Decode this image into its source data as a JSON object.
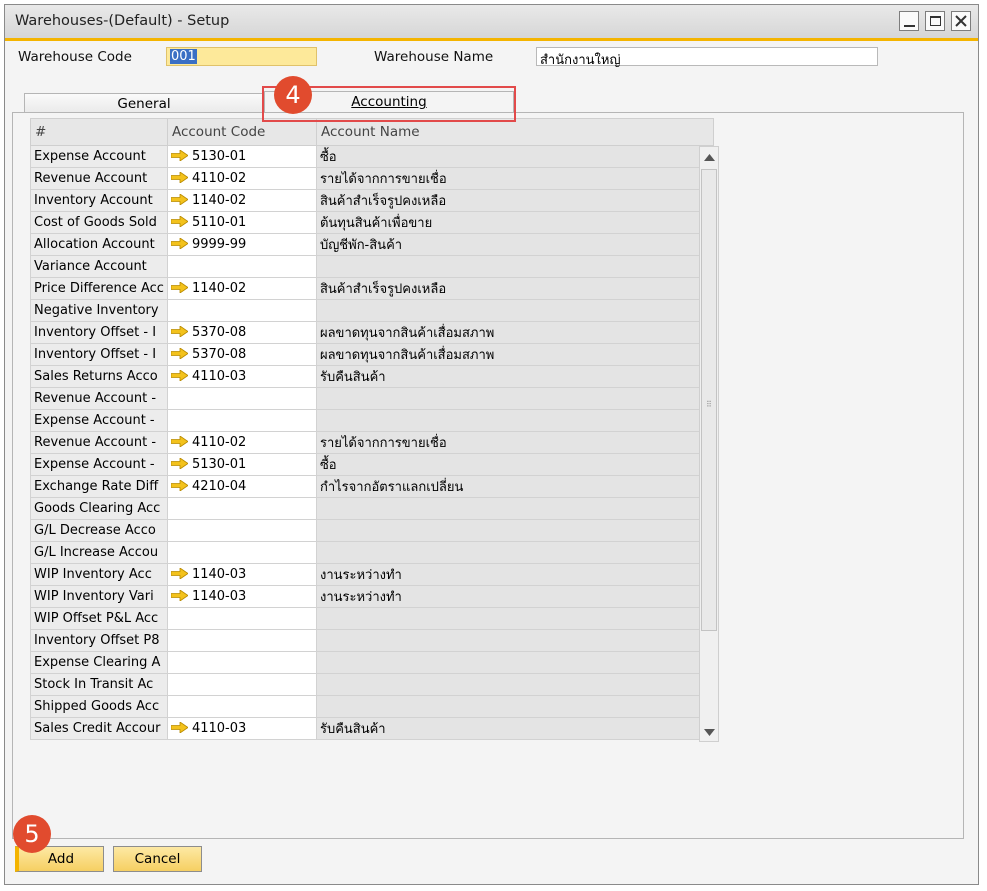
{
  "window": {
    "title": "Warehouses-(Default) - Setup"
  },
  "header": {
    "warehouse_code_label": "Warehouse Code",
    "warehouse_code_value": "001",
    "warehouse_name_label": "Warehouse Name",
    "warehouse_name_value": "สำนักงานใหญ่"
  },
  "tabs": {
    "general": "General",
    "accounting": "Accounting"
  },
  "grid": {
    "columns": [
      "#",
      "Account Code",
      "Account Name"
    ],
    "rows": [
      {
        "label": "Expense Account",
        "code": "5130-01",
        "name": "ซื้อ"
      },
      {
        "label": "Revenue Account",
        "code": "4110-02",
        "name": "รายได้จากการขายเชื่อ"
      },
      {
        "label": "Inventory Account",
        "code": "1140-02",
        "name": "สินค้าสำเร็จรูปคงเหลือ"
      },
      {
        "label": "Cost of Goods Sold",
        "code": "5110-01",
        "name": "ต้นทุนสินค้าเพื่อขาย"
      },
      {
        "label": "Allocation Account",
        "code": "9999-99",
        "name": "บัญชีพัก-สินค้า"
      },
      {
        "label": "Variance Account",
        "code": "",
        "name": ""
      },
      {
        "label": "Price Difference Acc",
        "code": "1140-02",
        "name": "สินค้าสำเร็จรูปคงเหลือ"
      },
      {
        "label": "Negative Inventory",
        "code": "",
        "name": ""
      },
      {
        "label": "Inventory Offset - I",
        "code": "5370-08",
        "name": "ผลขาดทุนจากสินค้าเสื่อมสภาพ"
      },
      {
        "label": "Inventory Offset - I",
        "code": "5370-08",
        "name": "ผลขาดทุนจากสินค้าเสื่อมสภาพ"
      },
      {
        "label": "Sales Returns Acco",
        "code": "4110-03",
        "name": "รับคืนสินค้า"
      },
      {
        "label": "Revenue Account -",
        "code": "",
        "name": ""
      },
      {
        "label": "Expense Account -",
        "code": "",
        "name": ""
      },
      {
        "label": "Revenue Account -",
        "code": "4110-02",
        "name": "รายได้จากการขายเชื่อ"
      },
      {
        "label": "Expense Account -",
        "code": "5130-01",
        "name": "ซื้อ"
      },
      {
        "label": "Exchange Rate Diff",
        "code": "4210-04",
        "name": "กำไรจากอัตราแลกเปลี่ยน"
      },
      {
        "label": "Goods Clearing Acc",
        "code": "",
        "name": ""
      },
      {
        "label": "G/L Decrease Acco",
        "code": "",
        "name": ""
      },
      {
        "label": "G/L Increase Accou",
        "code": "",
        "name": ""
      },
      {
        "label": "WIP Inventory Acc",
        "code": "1140-03",
        "name": "งานระหว่างทำ"
      },
      {
        "label": "WIP Inventory Vari",
        "code": "1140-03",
        "name": "งานระหว่างทำ"
      },
      {
        "label": "WIP Offset P&L Acc",
        "code": "",
        "name": ""
      },
      {
        "label": "Inventory Offset P8",
        "code": "",
        "name": ""
      },
      {
        "label": "Expense Clearing A",
        "code": "",
        "name": ""
      },
      {
        "label": "Stock In Transit Ac",
        "code": "",
        "name": ""
      },
      {
        "label": "Shipped Goods Acc",
        "code": "",
        "name": ""
      },
      {
        "label": "Sales Credit Accour",
        "code": "4110-03",
        "name": "รับคืนสินค้า"
      }
    ]
  },
  "buttons": {
    "add": "Add",
    "cancel": "Cancel"
  },
  "callouts": {
    "accounting_tab": "4",
    "add_button": "5"
  },
  "icons": {
    "link_arrow": "golden-arrow-icon",
    "expand": "expand-icon"
  },
  "colors": {
    "accent": "#f4b400",
    "callout": "#e14b2e",
    "button": "#f6cf62"
  }
}
